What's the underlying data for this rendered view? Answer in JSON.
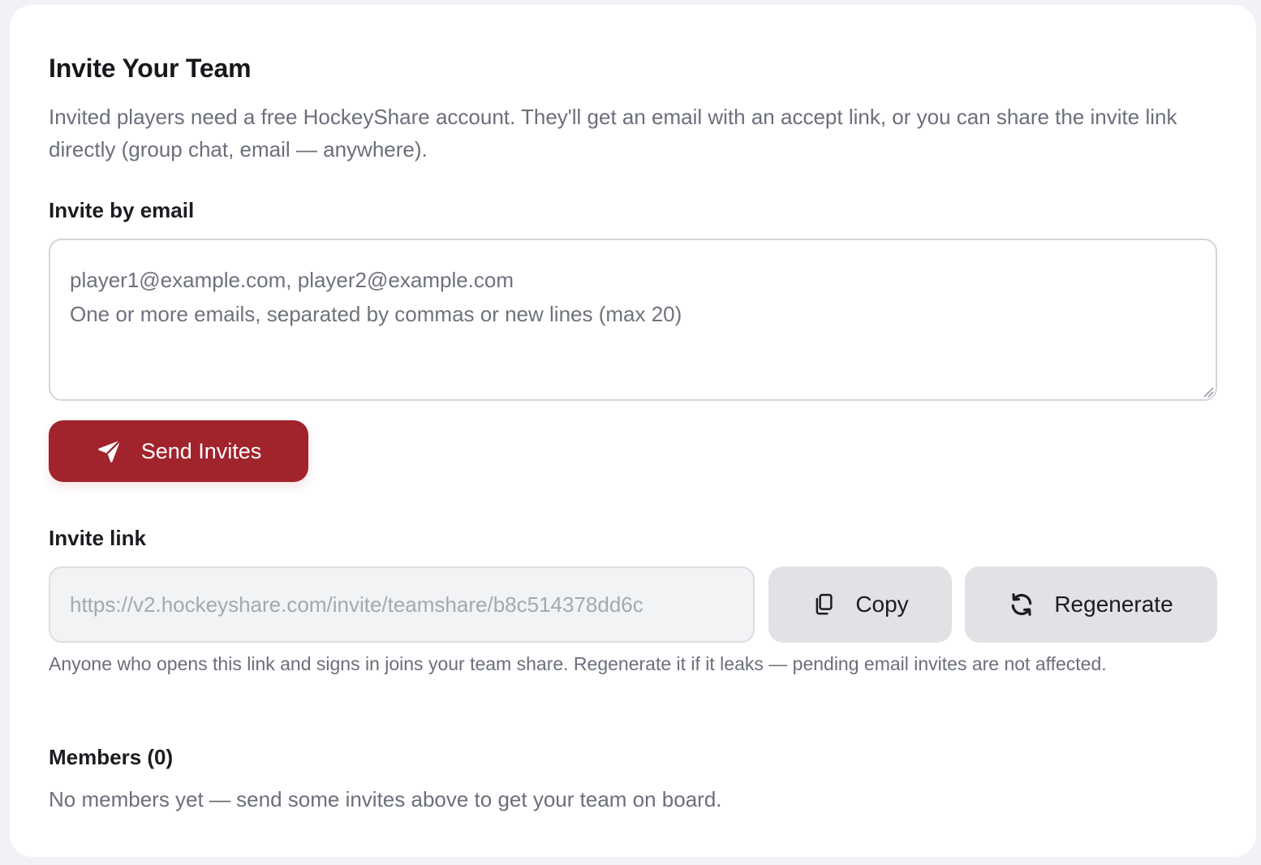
{
  "header": {
    "title": "Invite Your Team",
    "subtitle": "Invited players need a free HockeyShare account. They'll get an email with an accept link, or you can share the invite link directly (group chat, email — anywhere)."
  },
  "invite_email": {
    "label": "Invite by email",
    "placeholder": "player1@example.com, player2@example.com\nOne or more emails, separated by commas or new lines (max 20)",
    "value": "",
    "send_button": {
      "label": "Send Invites",
      "icon": "send-icon",
      "color": "#a1232c"
    }
  },
  "invite_link": {
    "label": "Invite link",
    "url": "https://v2.hockeyshare.com/invite/teamshare/b8c514378dd6c",
    "copy_button": {
      "label": "Copy",
      "icon": "copy-icon"
    },
    "regenerate_button": {
      "label": "Regenerate",
      "icon": "refresh-icon"
    },
    "help": "Anyone who opens this link and signs in joins your team share. Regenerate it if it leaks — pending email invites are not affected."
  },
  "members": {
    "label": "Members (0)",
    "empty_text": "No members yet — send some invites above to get your team on board."
  }
}
